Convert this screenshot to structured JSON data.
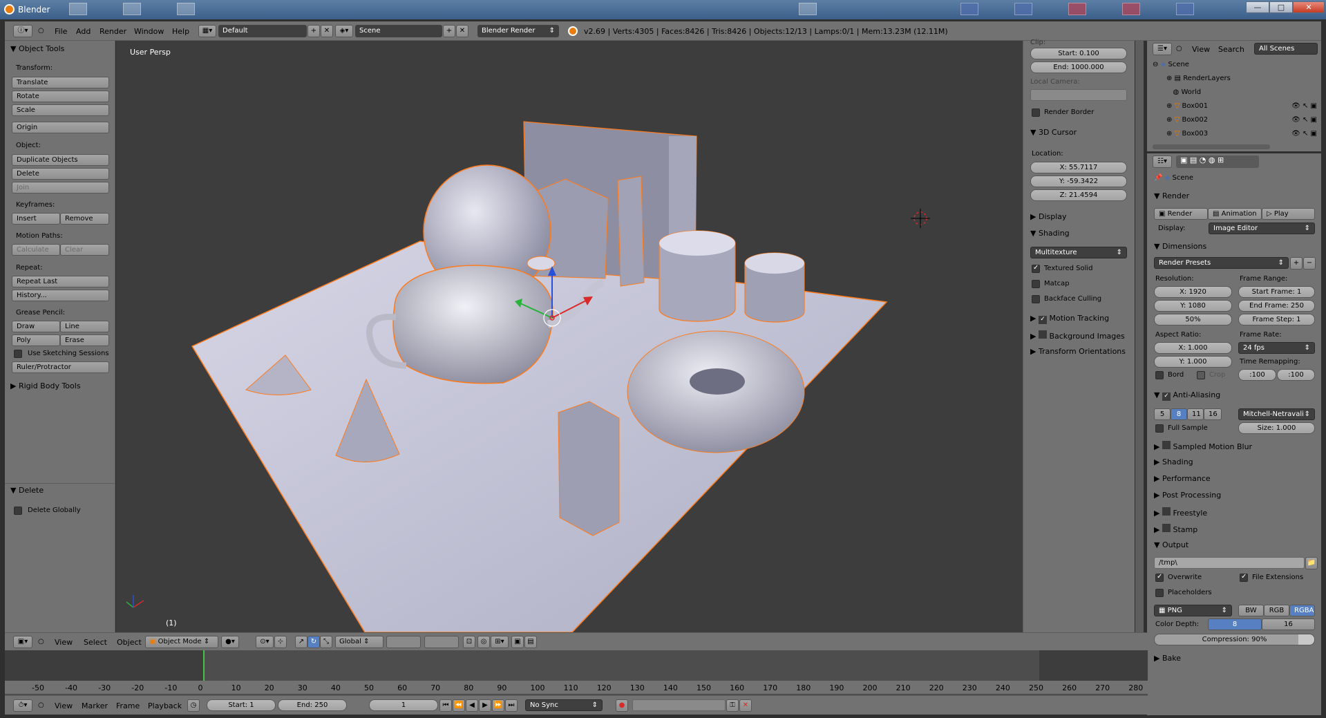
{
  "window": {
    "title": "Blender",
    "min_icon": "—",
    "max_icon": "□",
    "close_icon": "✕"
  },
  "menus": [
    "File",
    "Add",
    "Render",
    "Window",
    "Help"
  ],
  "screen_layout": "Default",
  "scene_name": "Scene",
  "render_engine": "Blender Render",
  "stats": "v2.69 | Verts:4305 | Faces:8426 | Tris:8426 | Objects:12/13 | Lamps:0/1 | Mem:13.23M (12.11M)",
  "toolshelf": {
    "title": "Object Tools",
    "transform_label": "Transform:",
    "translate": "Translate",
    "rotate": "Rotate",
    "scale": "Scale",
    "origin": "Origin",
    "object_label": "Object:",
    "duplicate": "Duplicate Objects",
    "delete": "Delete",
    "join": "Join",
    "keyframes_label": "Keyframes:",
    "insert": "Insert",
    "remove": "Remove",
    "motion_paths_label": "Motion Paths:",
    "calculate": "Calculate",
    "clear": "Clear",
    "repeat_label": "Repeat:",
    "repeat_last": "Repeat Last",
    "history": "History...",
    "grease_label": "Grease Pencil:",
    "draw": "Draw",
    "line": "Line",
    "poly": "Poly",
    "erase": "Erase",
    "sketching": "Use Sketching Sessions",
    "ruler": "Ruler/Protractor",
    "rigid": "Rigid Body Tools",
    "op_title": "Delete",
    "delete_globally": "Delete Globally"
  },
  "viewport": {
    "label": "User Persp",
    "frame": "(1)"
  },
  "npanel": {
    "clip_label": "Clip:",
    "clip_start": "Start: 0.100",
    "clip_end": "End: 1000.000",
    "local_camera": "Local Camera:",
    "render_border": "Render Border",
    "cursor_title": "3D Cursor",
    "location_label": "Location:",
    "x": "X: 55.7117",
    "y": "Y: -59.3422",
    "z": "Z: 21.4594",
    "display": "Display",
    "shading": "Shading",
    "shading_mode": "Multitexture",
    "textured_solid": "Textured Solid",
    "matcap": "Matcap",
    "backface": "Backface Culling",
    "motion_tracking": "Motion Tracking",
    "background_images": "Background Images",
    "transform_orientations": "Transform Orientations"
  },
  "outliner": {
    "view": "View",
    "search": "Search",
    "filter": "All Scenes",
    "items": [
      "Scene",
      "RenderLayers",
      "World",
      "Box001",
      "Box002",
      "Box003"
    ]
  },
  "props": {
    "context": "Scene",
    "render_title": "Render",
    "render_btn": "Render",
    "animation_btn": "Animation",
    "play_btn": "Play",
    "display_label": "Display:",
    "display_value": "Image Editor",
    "dimensions": "Dimensions",
    "render_presets": "Render Presets",
    "resolution_label": "Resolution:",
    "res_x": "X: 1920",
    "res_y": "Y: 1080",
    "res_pct": "50%",
    "frame_range_label": "Frame Range:",
    "start_frame": "Start Frame: 1",
    "end_frame": "End Frame: 250",
    "frame_step": "Frame Step: 1",
    "aspect_label": "Aspect Ratio:",
    "asp_x": "X: 1.000",
    "asp_y": "Y: 1.000",
    "frame_rate_label": "Frame Rate:",
    "fps": "24 fps",
    "time_remap_label": "Time Remapping:",
    "remap_old": ":100",
    "remap_new": ":100",
    "bord": "Bord",
    "crop": "Crop",
    "aa_title": "Anti-Aliasing",
    "aa_samples": [
      "5",
      "8",
      "11",
      "16"
    ],
    "aa_filter": "Mitchell-Netravali",
    "full_sample": "Full Sample",
    "size": "Size: 1.000",
    "motion_blur": "Sampled Motion Blur",
    "shading": "Shading",
    "performance": "Performance",
    "post_processing": "Post Processing",
    "freestyle": "Freestyle",
    "stamp": "Stamp",
    "output_title": "Output",
    "output_path": "/tmp\\",
    "overwrite": "Overwrite",
    "file_ext": "File Extensions",
    "placeholders": "Placeholders",
    "format": "PNG",
    "bw": "BW",
    "rgb": "RGB",
    "rgba": "RGBA",
    "color_depth_label": "Color Depth:",
    "depth_8": "8",
    "depth_16": "16",
    "compression": "Compression: 90%",
    "bake": "Bake"
  },
  "view_header": {
    "view": "View",
    "select": "Select",
    "object": "Object",
    "mode": "Object Mode",
    "orientation": "Global"
  },
  "timeline": {
    "ticks": [
      "-50",
      "-40",
      "-30",
      "-20",
      "-10",
      "0",
      "10",
      "20",
      "30",
      "40",
      "50",
      "60",
      "70",
      "80",
      "90",
      "100",
      "110",
      "120",
      "130",
      "140",
      "150",
      "160",
      "170",
      "180",
      "190",
      "200",
      "210",
      "220",
      "230",
      "240",
      "250",
      "260",
      "270",
      "280"
    ],
    "view": "View",
    "marker": "Marker",
    "frame": "Frame",
    "playback": "Playback",
    "start": "Start: 1",
    "end": "End: 250",
    "current": "1",
    "sync": "No Sync"
  },
  "colors": {
    "selection_outline": "#ff7a1a",
    "panel_bg": "#727272",
    "viewport_bg": "#3d3d3d",
    "accent_blue": "#5680c2"
  }
}
